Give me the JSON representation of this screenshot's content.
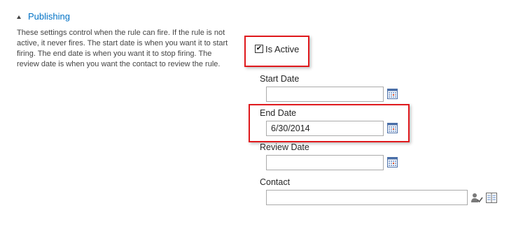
{
  "section": {
    "title": "Publishing",
    "description": "These settings control when the rule can fire. If the rule is not active, it never fires. The start date is when you want it to start firing. The end date is when you want it to stop firing. The review date is when you want the contact to review the rule."
  },
  "is_active": {
    "label": "Is Active",
    "checked": true
  },
  "start_date": {
    "label": "Start Date",
    "value": ""
  },
  "end_date": {
    "label": "End Date",
    "value": "6/30/2014"
  },
  "review_date": {
    "label": "Review Date",
    "value": ""
  },
  "contact": {
    "label": "Contact",
    "value": ""
  },
  "icons": {
    "section_toggle": "collapse-triangle-icon",
    "calendar": "calendar-icon",
    "check_names": "check-names-icon",
    "browse": "address-book-icon"
  },
  "colors": {
    "highlight": "#e0191d",
    "link": "#0072c6"
  }
}
